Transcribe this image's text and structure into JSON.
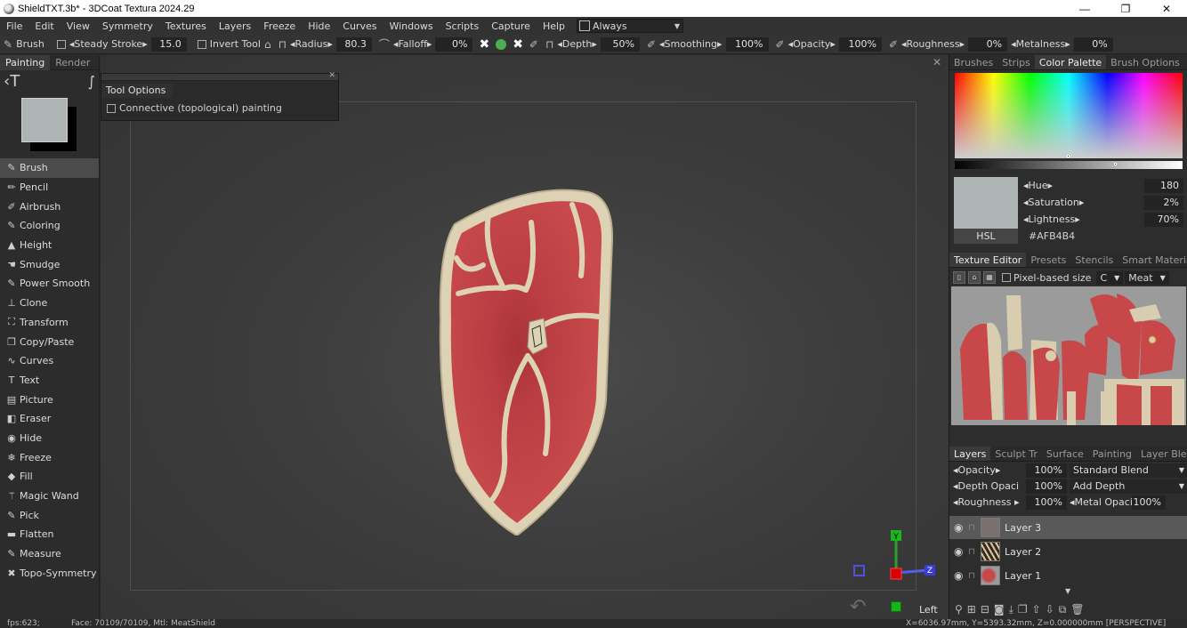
{
  "window": {
    "title": "ShieldTXT.3b* - 3DCoat Textura 2024.29",
    "minimize": "—",
    "maximize": "❐",
    "close": "✕"
  },
  "menu": {
    "items": [
      "File",
      "Edit",
      "View",
      "Symmetry",
      "Textures",
      "Layers",
      "Freeze",
      "Hide",
      "Curves",
      "Windows",
      "Scripts",
      "Capture",
      "Help"
    ],
    "always_label": "Always"
  },
  "toolbar": {
    "tool_name": "Brush",
    "steady_stroke_label": "Steady Stroke",
    "steady_stroke_value": "15.0",
    "invert_tool_label": "Invert Tool",
    "radius_label": "Radius",
    "radius_value": "80.3",
    "falloff_label": "Falloff",
    "falloff_value": "0%",
    "depth_label": "Depth",
    "depth_value": "50%",
    "smoothing_label": "Smoothing",
    "smoothing_value": "100%",
    "opacity_label": "Opacity",
    "opacity_value": "100%",
    "roughness_label": "Roughness",
    "roughness_value": "0%",
    "metalness_label": "Metalness",
    "metalness_value": "0%"
  },
  "left_panel": {
    "tabs": [
      "Painting",
      "Render"
    ],
    "swatch_color": "#AFB4B4",
    "tools": [
      {
        "label": "Brush",
        "icon": "✎"
      },
      {
        "label": "Pencil",
        "icon": "✏"
      },
      {
        "label": "Airbrush",
        "icon": "✐"
      },
      {
        "label": "Coloring",
        "icon": "✎"
      },
      {
        "label": "Height",
        "icon": "▲"
      },
      {
        "label": "Smudge",
        "icon": "☚"
      },
      {
        "label": "Power Smooth",
        "icon": "✎"
      },
      {
        "label": "Clone",
        "icon": "⊥"
      },
      {
        "label": "Transform",
        "icon": "⛶"
      },
      {
        "label": "Copy/Paste",
        "icon": "❐"
      },
      {
        "label": "Curves",
        "icon": "∿"
      },
      {
        "label": "Text",
        "icon": "T"
      },
      {
        "label": "Picture",
        "icon": "▤"
      },
      {
        "label": "Eraser",
        "icon": "◧"
      },
      {
        "label": "Hide",
        "icon": "◉"
      },
      {
        "label": "Freeze",
        "icon": "❄"
      },
      {
        "label": "Fill",
        "icon": "◆"
      },
      {
        "label": "Magic Wand",
        "icon": "⚚"
      },
      {
        "label": "Pick",
        "icon": "✎"
      },
      {
        "label": "Flatten",
        "icon": "▬"
      },
      {
        "label": "Measure",
        "icon": "✎"
      },
      {
        "label": "Topo-Symmetry",
        "icon": "✖"
      }
    ]
  },
  "viewport": {
    "tool_options_title": "Tool Options",
    "connective_label": "Connective (topological) painting",
    "view_label": "Left",
    "gizmo": {
      "y": "Y",
      "z": "Z"
    }
  },
  "status": {
    "fps": "fps:623;",
    "faces": "Face: 70109/70109, Mtl: MeatShield",
    "coords": "X=6036.97mm, Y=5393.32mm, Z=0.000000mm  [PERSPECTIVE]"
  },
  "right_panel": {
    "top_tabs": [
      "Brushes",
      "Strips",
      "Color Palette",
      "Brush Options"
    ],
    "hue_label": "Hue",
    "hue_value": "180",
    "saturation_label": "Saturation",
    "saturation_value": "2%",
    "lightness_label": "Lightness",
    "lightness_value": "70%",
    "mode": "HSL",
    "hex": "#AFB4B4",
    "tex_tabs": [
      "Texture Editor",
      "Presets",
      "Stencils",
      "Smart Materials"
    ],
    "pixel_based_label": "Pixel-based size",
    "channel_value": "C",
    "material_value": "Meat",
    "layer_tabs": [
      "Layers",
      "Sculpt Tr",
      "Surface",
      "Painting",
      "Layer Blending"
    ],
    "layer_opacity_label": "Opacity",
    "layer_opacity_value": "100%",
    "blend_mode": "Standard Blend",
    "depth_opacity_label": "Depth Opaci",
    "depth_opacity_value": "100%",
    "depth_mode": "Add Depth",
    "roughness_label": "Roughness",
    "roughness_value": "100%",
    "metal_opacity_label": "Metal Opacit",
    "metal_opacity_value": "100%",
    "layers": [
      {
        "name": "Layer 3",
        "active": true
      },
      {
        "name": "Layer 2",
        "active": false
      },
      {
        "name": "Layer 1",
        "active": false
      }
    ]
  }
}
